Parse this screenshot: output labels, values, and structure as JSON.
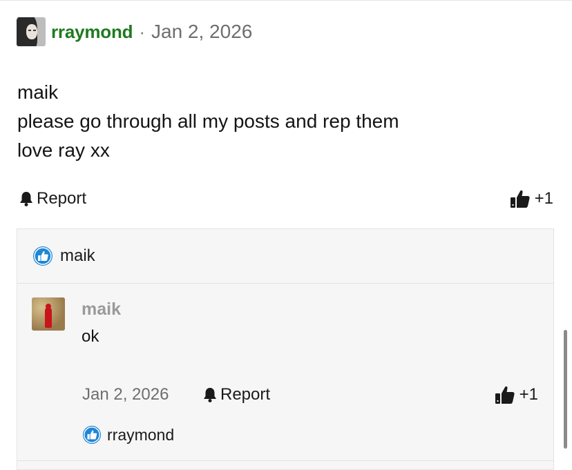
{
  "post": {
    "author": "rraymond",
    "separator": "·",
    "date": "Jan 2, 2026",
    "body_lines": [
      "maik",
      "please go through all my posts and rep them",
      "love ray xx"
    ],
    "report_label": "Report",
    "rep_label": "+1"
  },
  "likes": {
    "names": [
      "maik"
    ]
  },
  "comment": {
    "author": "maik",
    "text": "ok",
    "date": "Jan 2, 2026",
    "report_label": "Report",
    "rep_label": "+1",
    "liked_by": "rraymond"
  },
  "colors": {
    "author_green": "#1f7a1f",
    "like_blue": "#1e86d6",
    "muted": "#6e6e6e"
  },
  "icons": {
    "report": "bell-icon",
    "rep": "thumbs-up-icon",
    "like_badge": "like-badge-icon"
  }
}
